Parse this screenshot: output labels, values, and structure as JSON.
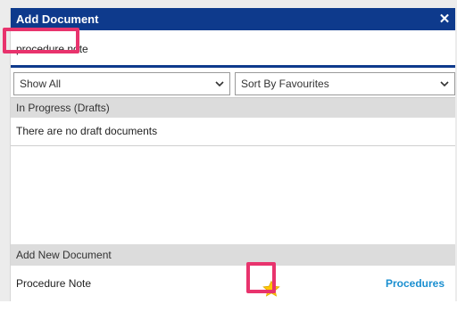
{
  "dialog": {
    "title": "Add Document",
    "close_glyph": "✕"
  },
  "search": {
    "value": "procedure note"
  },
  "filters": {
    "show": "Show All",
    "sort": "Sort By Favourites"
  },
  "drafts": {
    "header": "In Progress (Drafts)",
    "empty_message": "There are no draft documents"
  },
  "add_new": {
    "header": "Add New Document",
    "items": [
      {
        "name": "Procedure Note",
        "category": "Procedures",
        "favourite_icon": "star-icon"
      }
    ]
  },
  "colors": {
    "titlebar": "#0e3a8c",
    "highlight": "#e8336d",
    "link": "#1a8fd0",
    "star": "#ffc800"
  }
}
